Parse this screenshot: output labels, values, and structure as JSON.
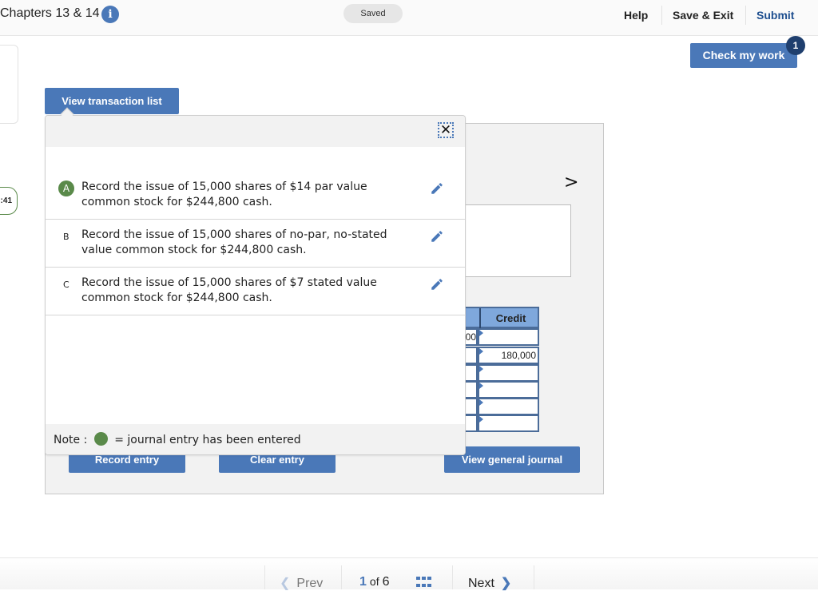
{
  "header": {
    "title": "Chapters 13 & 14",
    "status": "Saved",
    "nav": {
      "help": "Help",
      "save_exit": "Save & Exit",
      "submit": "Submit"
    }
  },
  "check_work": {
    "label": "Check my work",
    "badge": "1"
  },
  "timer": {
    "text": ":41"
  },
  "transaction_list": {
    "button_label": "View transaction list",
    "items": [
      {
        "letter": "A",
        "completed": true,
        "text": "Record the issue of 15,000 shares of $14 par value common stock for $244,800 cash."
      },
      {
        "letter": "B",
        "completed": false,
        "text": "Record the issue of 15,000 shares of no-par, no-stated value common stock for $244,800 cash."
      },
      {
        "letter": "C",
        "completed": false,
        "text": "Record the issue of 15,000 shares of $7 stated value common stock for $244,800 cash."
      }
    ],
    "note_prefix": "Note :",
    "note_suffix": "= journal entry has been entered"
  },
  "journal": {
    "credit_header": "Credit",
    "rows": [
      {
        "debit": "00",
        "credit": ""
      },
      {
        "debit": "",
        "credit": "180,000"
      },
      {
        "debit": "",
        "credit": ""
      },
      {
        "debit": "",
        "credit": ""
      },
      {
        "debit": "",
        "credit": ""
      },
      {
        "debit": "",
        "credit": ""
      }
    ]
  },
  "actions": {
    "record_entry": "Record entry",
    "clear_entry": "Clear entry",
    "view_general_journal": "View general journal"
  },
  "footer": {
    "prev": "Prev",
    "current_page": "1",
    "of": "of",
    "total_pages": "6",
    "next": "Next"
  },
  "colors": {
    "accent": "#4a78b8",
    "completed": "#5a8a4a",
    "submit": "#1d4e8f"
  }
}
